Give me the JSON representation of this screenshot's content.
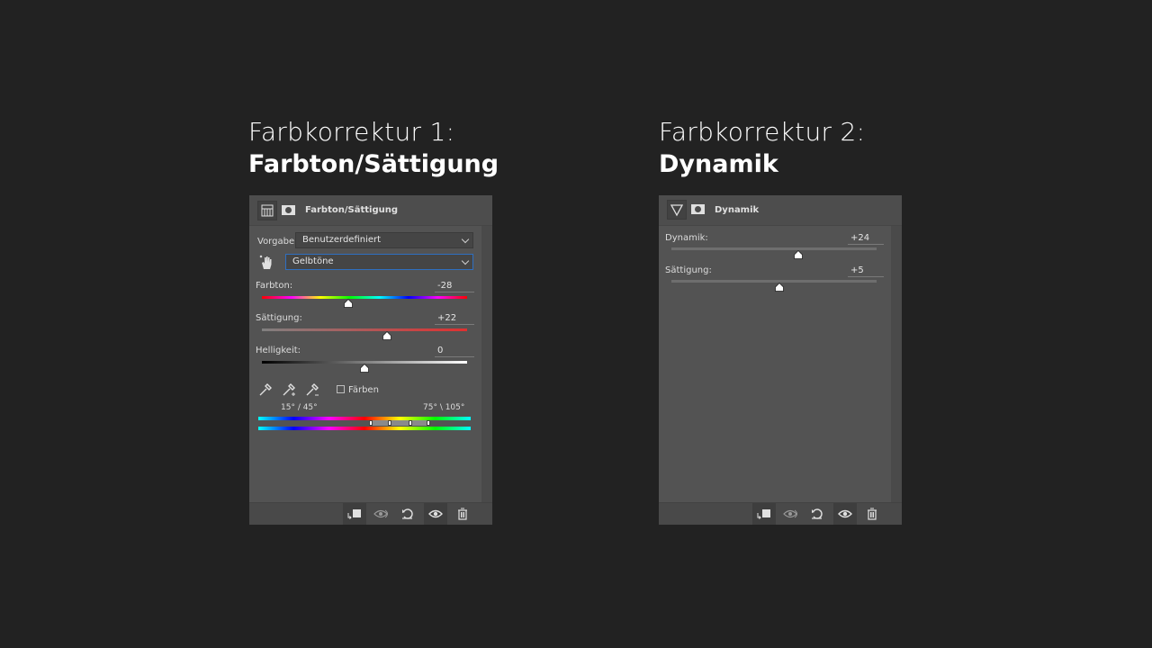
{
  "panel1": {
    "heading_line1": "Farbkorrektur 1:",
    "heading_line2": "Farbton/Sättigung",
    "title": "Farbton/Sättigung",
    "preset_label": "Vorgabe:",
    "preset_value": "Benutzerdefiniert",
    "range_value": "Gelbtöne",
    "hue": {
      "label": "Farbton:",
      "value": "-28",
      "level": -28,
      "min": -180,
      "max": 180
    },
    "saturation": {
      "label": "Sättigung:",
      "value": "+22",
      "level": 22,
      "min": -100,
      "max": 100
    },
    "lightness": {
      "label": "Helligkeit:",
      "value": "0",
      "level": 0,
      "min": -100,
      "max": 100
    },
    "colorize_label": "Färben",
    "colorize_checked": false,
    "range_left": "15° /  45°",
    "range_right": "75° \\  105°"
  },
  "panel2": {
    "heading_line1": "Farbkorrektur 2:",
    "heading_line2": "Dynamik",
    "title": "Dynamik",
    "vibrance": {
      "label": "Dynamik:",
      "value": "+24",
      "level": 24,
      "min": -100,
      "max": 100
    },
    "saturation": {
      "label": "Sättigung:",
      "value": "+5",
      "level": 5,
      "min": -100,
      "max": 100
    }
  },
  "footer_icons": [
    "clip-to-layer-icon",
    "view-previous-icon",
    "reset-icon",
    "visibility-icon",
    "trash-icon"
  ],
  "colors": {
    "background": "#222222",
    "panel": "#535353",
    "accent_focus": "#2f6fc0",
    "saturation_track": "#e03030"
  }
}
